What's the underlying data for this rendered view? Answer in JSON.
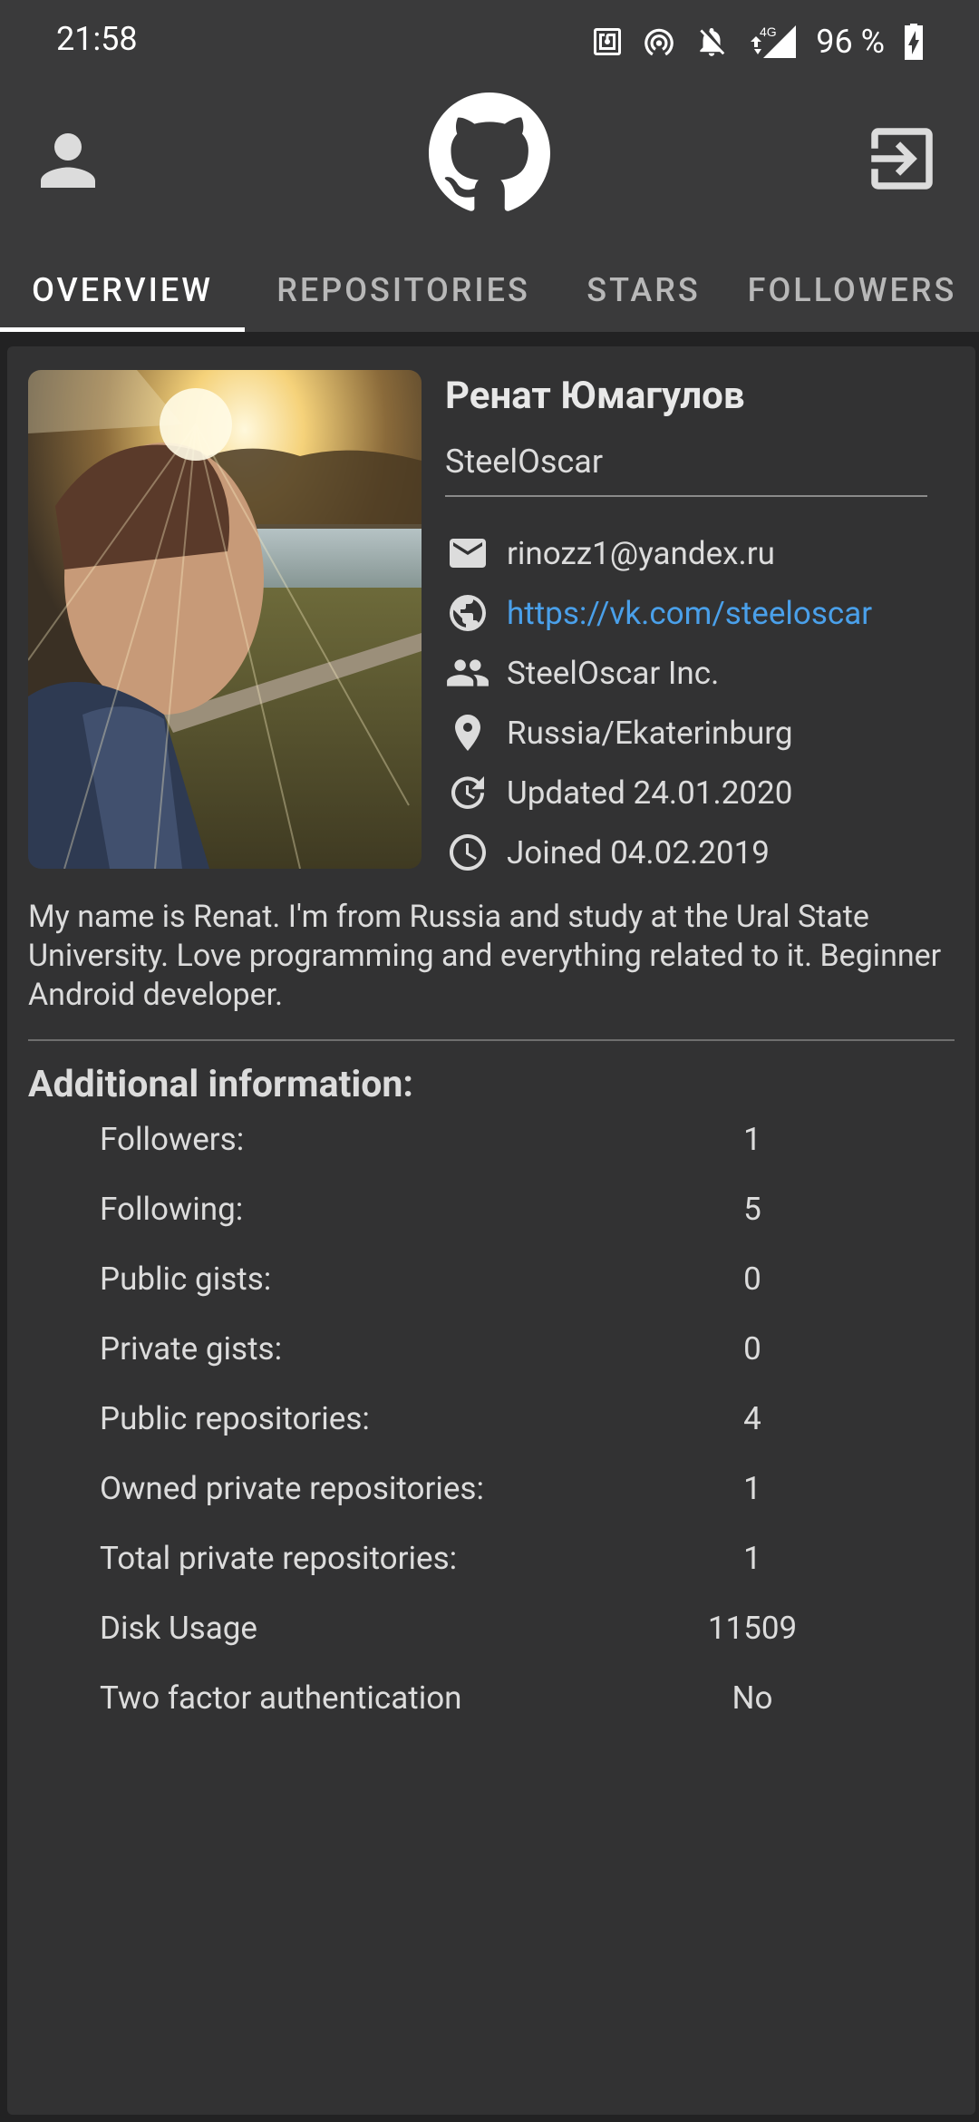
{
  "status_bar": {
    "time": "21:58",
    "battery": "96 %",
    "icons": [
      "nfc-icon",
      "hotspot-icon",
      "bell-off-icon",
      "signal-4g-icon",
      "battery-charging-icon"
    ],
    "signal_label": "4G"
  },
  "app_bar": {
    "left_icon": "person-icon",
    "center_icon": "github-icon",
    "right_icon": "logout-icon"
  },
  "tabs": [
    {
      "label": "OVERVIEW",
      "active": true
    },
    {
      "label": "REPOSITORIES",
      "active": false
    },
    {
      "label": "STARS",
      "active": false
    },
    {
      "label": "FOLLOWERS",
      "active": false
    }
  ],
  "profile": {
    "name": "Ренат Юмагулов",
    "login": "SteelOscar",
    "email": "rinozz1@yandex.ru",
    "website": "https://vk.com/steeloscar",
    "company": "SteelOscar Inc.",
    "location": "Russia/Ekaterinburg",
    "updated": "Updated 24.01.2020",
    "joined": "Joined 04.02.2019",
    "bio": "My name is Renat. I'm from Russia and study at the Ural State University. Love programming and everything related to it. Beginner Android developer."
  },
  "additional": {
    "title": "Additional information:",
    "rows": [
      {
        "label": "Followers:",
        "value": "1"
      },
      {
        "label": "Following:",
        "value": "5"
      },
      {
        "label": "Public gists:",
        "value": "0"
      },
      {
        "label": "Private gists:",
        "value": "0"
      },
      {
        "label": "Public repositories:",
        "value": "4"
      },
      {
        "label": "Owned private repositories:",
        "value": "1"
      },
      {
        "label": "Total private repositories:",
        "value": "1"
      },
      {
        "label": "Disk Usage",
        "value": "11509"
      },
      {
        "label": "Two factor authentication",
        "value": "No"
      }
    ]
  },
  "colors": {
    "background": "#222223",
    "surface": "#323233",
    "app_bar": "#3a3a3b",
    "link": "#4aa0ea",
    "text": "#dcdcdc"
  }
}
